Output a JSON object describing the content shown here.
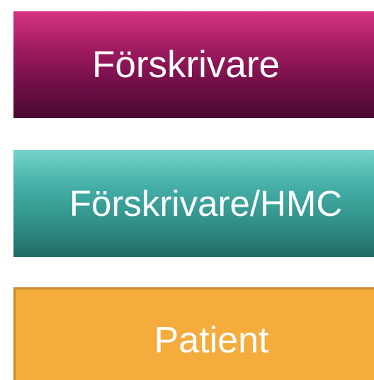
{
  "roles": [
    {
      "label": "Förskrivare",
      "color_top": "#d43381",
      "color_bottom": "#4a0a2f"
    },
    {
      "label": "Förskrivare/HMC",
      "color_top": "#73d2c8",
      "color_bottom": "#236a64"
    },
    {
      "label": "Patient",
      "color": "#f4ac3d",
      "border_color": "#c98a2a"
    }
  ]
}
